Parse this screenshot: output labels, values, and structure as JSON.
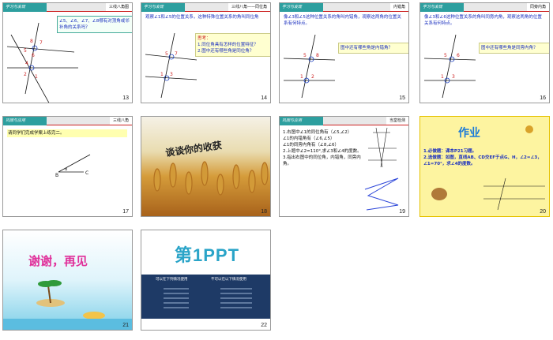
{
  "slides": [
    {
      "num": "13",
      "tag": "学习与发现",
      "title": "三线八角图",
      "text": "∠5、∠6、∠7、∠8哪有对顶角或邻补角的关系吗？"
    },
    {
      "num": "14",
      "tag": "学习与发现",
      "title": "三线八角——同位角",
      "text": "观察∠1和∠5的位置关系，这种特殊位置关系的角叫同位角",
      "note1": "思考：",
      "note2": "1.同位角具有怎样的位置特征？",
      "note3": "2.图中还有哪些角是同位角？"
    },
    {
      "num": "15",
      "tag": "学习与发现",
      "title": "内错角",
      "text": "像∠3和∠5这种位置关系的角叫内错角，观察这两角的位置关系有何特点。",
      "note1": "图中还有哪些角是内错角？"
    },
    {
      "num": "16",
      "tag": "学习与发现",
      "title": "同旁内角",
      "text": "像∠3和∠6这种位置关系的角叫同旁内角，观察这两角的位置关系有何特点。",
      "note1": "图中还有哪些角是同旁内角？"
    },
    {
      "num": "17",
      "tag": "巩固与应用",
      "title": "三线八角",
      "text": "请同学们完成学案上练完二。"
    },
    {
      "num": "18",
      "text": "谈谈你的收获"
    },
    {
      "num": "19",
      "tag": "巩固与应用",
      "title": "当堂检测",
      "q1": "1.右图中∠1的同位角有（∠5,∠2）",
      "q1b": "∠1的内错角有（∠6,∠5）",
      "q1c": "∠1的同旁内角有（∠8,∠6）",
      "q2": "2.上题中∠2=110°,求∠3和∠4的度数。",
      "q3": "3.指出右图中的同位角，内错角，同旁内角。"
    },
    {
      "num": "20",
      "title": "作业",
      "hw1": "1.必做题：课本P",
      "hw1b": "习题。",
      "hw2": "2.选做题：如图，直线AB、CD交EF于点G、H，∠2=∠3，∠1=70°，求∠4的度数。"
    },
    {
      "num": "21",
      "text": "谢谢，再见"
    },
    {
      "num": "22",
      "logo": "第1PPT",
      "col1": "可以在下列情况使用",
      "col2": "不可以在以下情况使用"
    }
  ]
}
